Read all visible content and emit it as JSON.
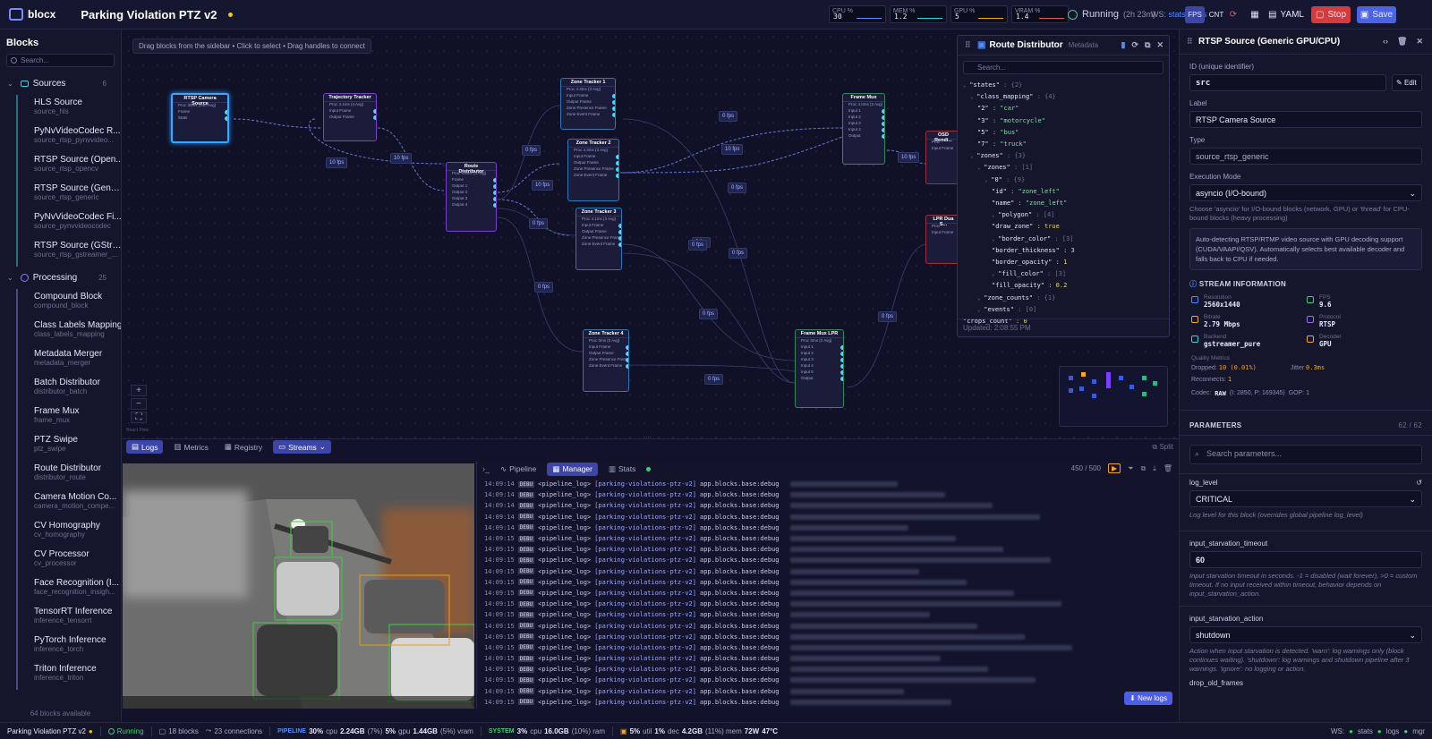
{
  "app": {
    "name": "blocx",
    "pipeline_title": "Parking Violation PTZ v2"
  },
  "monitors": [
    {
      "label": "CPU %",
      "value": "30",
      "color": "#5b8cff"
    },
    {
      "label": "MEM %",
      "value": "1.2",
      "color": "#3fd0e0"
    },
    {
      "label": "GPU %",
      "value": "5",
      "color": "#f5a623"
    },
    {
      "label": "VRAM %",
      "value": "1.4",
      "color": "#e05b5b"
    }
  ],
  "topbar": {
    "status": "Running",
    "uptime": "(2h 23m)",
    "ws_prefix": "WS:",
    "ws_links": "stats / logs",
    "fps_btn": "FPS",
    "cnt_btn": "CNT",
    "yaml_btn": "YAML",
    "stop_btn": "Stop",
    "save_btn": "Save"
  },
  "sidebar": {
    "title": "Blocks",
    "search_placeholder": "Search...",
    "sources": {
      "label": "Sources",
      "count": "6",
      "items": [
        {
          "name": "HLS Source",
          "type": "source_hls"
        },
        {
          "name": "PyNvVideoCodec R...",
          "type": "source_rtsp_pynvvideo..."
        },
        {
          "name": "RTSP Source (Open...",
          "type": "source_rtsp_opencv"
        },
        {
          "name": "RTSP Source (Gener...",
          "type": "source_rtsp_generic"
        },
        {
          "name": "PyNvVideoCodec Fi...",
          "type": "source_pynvvideocodec"
        },
        {
          "name": "RTSP Source (GStre...",
          "type": "source_rtsp_gstreamer_..."
        }
      ]
    },
    "processing": {
      "label": "Processing",
      "count": "25",
      "items": [
        {
          "name": "Compound Block",
          "type": "compound_block"
        },
        {
          "name": "Class Labels Mapping",
          "type": "class_labels_mapping"
        },
        {
          "name": "Metadata Merger",
          "type": "metadata_merger"
        },
        {
          "name": "Batch Distributor",
          "type": "distributor_batch"
        },
        {
          "name": "Frame Mux",
          "type": "frame_mux"
        },
        {
          "name": "PTZ Swipe",
          "type": "ptz_swipe"
        },
        {
          "name": "Route Distributor",
          "type": "distributor_route"
        },
        {
          "name": "Camera Motion Co...",
          "type": "camera_motion_compe..."
        },
        {
          "name": "CV Homography",
          "type": "cv_homography"
        },
        {
          "name": "CV Processor",
          "type": "cv_processor"
        },
        {
          "name": "Face Recognition (I...",
          "type": "face_recognition_insigh..."
        },
        {
          "name": "TensorRT Inference",
          "type": "inference_tensorrt"
        },
        {
          "name": "PyTorch Inference",
          "type": "inference_torch"
        },
        {
          "name": "Triton Inference",
          "type": "inference_triton"
        }
      ]
    },
    "footer": "64 blocks available"
  },
  "canvas": {
    "hint": "Drag blocks from the sidebar • Click to select • Drag handles to connect",
    "attribution": "React Flow",
    "nodes": [
      {
        "id": "rtsp",
        "title": "RTSP Camera Source",
        "rows": [
          "Proc 30ms (14fr.Avg)",
          "Frame",
          "Stats"
        ]
      },
      {
        "id": "traj",
        "title": "Trajectory Tracker",
        "rows": [
          "Proc 4.1ms (4 Avg)",
          "Input Frame",
          "Output Frame"
        ]
      },
      {
        "id": "route",
        "title": "Route Distributor",
        "rows": [
          "Proc 4.6ms (3 Avg)",
          "Frame",
          "Output 1",
          "Output 2",
          "Output 3",
          "Output 4"
        ]
      },
      {
        "id": "zt1",
        "title": "Zone Tracker 1",
        "rows": [
          "Proc 4.3ms (3 Avg)",
          "Input Frame",
          "Output Frame",
          "Zone Presence Frame",
          "Zone Event Frame"
        ]
      },
      {
        "id": "zt2",
        "title": "Zone Tracker 2",
        "rows": [
          "Proc 4.3ms (3 Avg)",
          "Input Frame",
          "Output Frame",
          "Zone Presence Frame",
          "Zone Event Frame"
        ]
      },
      {
        "id": "zt3",
        "title": "Zone Tracker 3",
        "rows": [
          "Proc 4.1ms (3 Avg)",
          "Input Frame",
          "Output Frame",
          "Zone Presence Frame",
          "Zone Event Frame"
        ]
      },
      {
        "id": "zt4",
        "title": "Zone Tracker 4",
        "rows": [
          "Proc 0ms (0 Avg)",
          "Input Frame",
          "Output Frame",
          "Zone Presence Frame",
          "Zone Event Frame"
        ]
      },
      {
        "id": "fmux",
        "title": "Frame Mux",
        "rows": [
          "Proc 4.0ms (3 Avg)",
          "Input 1",
          "Input 2",
          "Input 3",
          "Input 4",
          "Output"
        ]
      },
      {
        "id": "fmuxlpr",
        "title": "Frame Mux LPR",
        "rows": [
          "Proc 0ms (0 Avg)",
          "Input 1",
          "Input 2",
          "Input 3",
          "Input 4",
          "Input 5",
          "Output"
        ]
      },
      {
        "id": "osd",
        "title": "OSD Rendi...",
        "rows": [
          "Proc",
          "Input Frame"
        ]
      },
      {
        "id": "lpr",
        "title": "LPR Dua S...",
        "rows": [
          "Proc",
          "Input Frame"
        ]
      }
    ],
    "fps_labels": [
      "10 fps",
      "10 fps",
      "0 fps",
      "0 fps",
      "10 fps",
      "0 fps",
      "10 fps",
      "0 fps",
      "0 fps",
      "0 fps",
      "0 fps",
      "0 fps",
      "0 fps",
      "0 fps",
      "0 fps",
      "10 fps"
    ]
  },
  "route_panel": {
    "title": "Route Distributor",
    "subtitle": "Metadata",
    "search_placeholder": "Search...",
    "json_lines": [
      {
        "indent": 0,
        "key": "\"states\"",
        "val": ": {2}",
        "t": "g"
      },
      {
        "indent": 1,
        "key": "\"class_mapping\"",
        "val": ": {4}",
        "t": "g"
      },
      {
        "indent": 2,
        "key": "\"2\"",
        "val": ": \"car\"",
        "t": "s"
      },
      {
        "indent": 2,
        "key": "\"3\"",
        "val": ": \"motorcycle\"",
        "t": "s"
      },
      {
        "indent": 2,
        "key": "\"5\"",
        "val": ": \"bus\"",
        "t": "s"
      },
      {
        "indent": 2,
        "key": "\"7\"",
        "val": ": \"truck\"",
        "t": "s"
      },
      {
        "indent": 1,
        "key": "\"zones\"",
        "val": ": {3}",
        "t": "g"
      },
      {
        "indent": 2,
        "key": "\"zones\"",
        "val": ": [1]",
        "t": "g"
      },
      {
        "indent": 3,
        "key": "\"0\"",
        "val": ": {9}",
        "t": "g"
      },
      {
        "indent": 4,
        "key": "\"id\"",
        "val": ": \"zone_left\"",
        "t": "s"
      },
      {
        "indent": 4,
        "key": "\"name\"",
        "val": ": \"zone_left\"",
        "t": "s"
      },
      {
        "indent": 4,
        "key": "\"polygon\"",
        "val": ": [4]",
        "t": "g"
      },
      {
        "indent": 4,
        "key": "\"draw_zone\"",
        "val": ": true",
        "t": "n"
      },
      {
        "indent": 4,
        "key": "\"border_color\"",
        "val": ": [3]",
        "t": "g"
      },
      {
        "indent": 4,
        "key": "\"border_thickness\"",
        "val": ": 3",
        "t": "n"
      },
      {
        "indent": 4,
        "key": "\"border_opacity\"",
        "val": ": 1",
        "t": "n"
      },
      {
        "indent": 4,
        "key": "\"fill_color\"",
        "val": ": [3]",
        "t": "g"
      },
      {
        "indent": 4,
        "key": "\"fill_opacity\"",
        "val": ": 0.2",
        "t": "n"
      },
      {
        "indent": 2,
        "key": "\"zone_counts\"",
        "val": ": {1}",
        "t": "g"
      },
      {
        "indent": 2,
        "key": "\"events\"",
        "val": ": [0]",
        "t": "g"
      },
      {
        "indent": 0,
        "key": "\"crops_count\"",
        "val": ": 0",
        "t": "n"
      }
    ],
    "updated": "Updated: 2:08:55 PM"
  },
  "bottom": {
    "tabs": [
      "Logs",
      "Metrics",
      "Registry",
      "Streams"
    ],
    "split_label": "Split",
    "log_tabs": [
      "Pipeline",
      "Manager",
      "Stats"
    ],
    "log_count": "450 / 500",
    "new_logs_btn": "New logs",
    "log_rows": [
      {
        "time": "14:09:14",
        "level": "DEBU",
        "src": "<pipeline_log>",
        "pipe": "[parking-violations-ptz-v2]",
        "logger": "app.blocks.base:debug"
      },
      {
        "time": "14:09:14",
        "level": "DEBU",
        "src": "<pipeline_log>",
        "pipe": "[parking-violations-ptz-v2]",
        "logger": "app.blocks.base:debug"
      },
      {
        "time": "14:09:14",
        "level": "DEBU",
        "src": "<pipeline_log>",
        "pipe": "[parking-violations-ptz-v2]",
        "logger": "app.blocks.base:debug"
      },
      {
        "time": "14:09:14",
        "level": "DEBU",
        "src": "<pipeline_log>",
        "pipe": "[parking-violations-ptz-v2]",
        "logger": "app.blocks.base:debug"
      },
      {
        "time": "14:09:14",
        "level": "DEBU",
        "src": "<pipeline_log>",
        "pipe": "[parking-violations-ptz-v2]",
        "logger": "app.blocks.base:debug"
      },
      {
        "time": "14:09:15",
        "level": "DEBU",
        "src": "<pipeline_log>",
        "pipe": "[parking-violations-ptz-v2]",
        "logger": "app.blocks.base:debug"
      },
      {
        "time": "14:09:15",
        "level": "DEBU",
        "src": "<pipeline_log>",
        "pipe": "[parking-violations-ptz-v2]",
        "logger": "app.blocks.base:debug"
      },
      {
        "time": "14:09:15",
        "level": "DEBU",
        "src": "<pipeline_log>",
        "pipe": "[parking-violations-ptz-v2]",
        "logger": "app.blocks.base:debug"
      },
      {
        "time": "14:09:15",
        "level": "DEBU",
        "src": "<pipeline_log>",
        "pipe": "[parking-violations-ptz-v2]",
        "logger": "app.blocks.base:debug"
      },
      {
        "time": "14:09:15",
        "level": "DEBU",
        "src": "<pipeline_log>",
        "pipe": "[parking-violations-ptz-v2]",
        "logger": "app.blocks.base:debug"
      },
      {
        "time": "14:09:15",
        "level": "DEBU",
        "src": "<pipeline_log>",
        "pipe": "[parking-violations-ptz-v2]",
        "logger": "app.blocks.base:debug"
      },
      {
        "time": "14:09:15",
        "level": "DEBU",
        "src": "<pipeline_log>",
        "pipe": "[parking-violations-ptz-v2]",
        "logger": "app.blocks.base:debug"
      },
      {
        "time": "14:09:15",
        "level": "DEBU",
        "src": "<pipeline_log>",
        "pipe": "[parking-violations-ptz-v2]",
        "logger": "app.blocks.base:debug"
      },
      {
        "time": "14:09:15",
        "level": "DEBU",
        "src": "<pipeline_log>",
        "pipe": "[parking-violations-ptz-v2]",
        "logger": "app.blocks.base:debug"
      },
      {
        "time": "14:09:15",
        "level": "DEBU",
        "src": "<pipeline_log>",
        "pipe": "[parking-violations-ptz-v2]",
        "logger": "app.blocks.base:debug"
      },
      {
        "time": "14:09:15",
        "level": "DEBU",
        "src": "<pipeline_log>",
        "pipe": "[parking-violations-ptz-v2]",
        "logger": "app.blocks.base:debug"
      },
      {
        "time": "14:09:15",
        "level": "DEBU",
        "src": "<pipeline_log>",
        "pipe": "[parking-violations-ptz-v2]",
        "logger": "app.blocks.base:debug"
      },
      {
        "time": "14:09:15",
        "level": "DEBU",
        "src": "<pipeline_log>",
        "pipe": "[parking-violations-ptz-v2]",
        "logger": "app.blocks.base:debug"
      },
      {
        "time": "14:09:15",
        "level": "DEBU",
        "src": "<pipeline_log>",
        "pipe": "[parking-violations-ptz-v2]",
        "logger": "app.blocks.base:debug"
      },
      {
        "time": "14:09:15",
        "level": "DEBU",
        "src": "<pipeline_log>",
        "pipe": "[parking-violations-ptz-v2]",
        "logger": "app.blocks.base:debug"
      },
      {
        "time": "14:09:15",
        "level": "DEBU",
        "src": "<pipeline_log>",
        "pipe": "[parking-violations-ptz-v2]",
        "logger": "app.blocks.base:debug"
      }
    ]
  },
  "inspector": {
    "title": "RTSP Source (Generic GPU/CPU)",
    "id_label": "ID (unique identifier)",
    "id_value": "src",
    "edit_btn": "Edit",
    "label_label": "Label",
    "label_value": "RTSP Camera Source",
    "type_label": "Type",
    "type_value": "source_rtsp_generic",
    "exec_label": "Execution Mode",
    "exec_value": "asyncio (I/O-bound)",
    "exec_desc": "Choose 'asyncio' for I/O-bound blocks (network, GPU) or 'thread' for CPU-bound blocks (heavy processing)",
    "info": "Auto-detecting RTSP/RTMP video source with GPU decoding support (CUDA/VAAPI/QSV). Automatically selects best available decoder and falls back to CPU if needed.",
    "stream_title": "STREAM INFORMATION",
    "stream": [
      {
        "label": "Resolution",
        "value": "2560x1440",
        "color": "#4f8cff"
      },
      {
        "label": "FPS",
        "value": "9.6",
        "color": "#3ecf6e"
      },
      {
        "label": "Bitrate",
        "value": "2.79 Mbps",
        "color": "#f5a623"
      },
      {
        "label": "Protocol",
        "value": "RTSP",
        "color": "#a46bff"
      },
      {
        "label": "Backend",
        "value": "gstreamer_pure",
        "color": "#3fd0e0"
      },
      {
        "label": "Decoder",
        "value": "GPU",
        "color": "#f5a623"
      }
    ],
    "quality_title": "Quality Metrics",
    "dropped_label": "Dropped:",
    "dropped_value": "10 (0.01%)",
    "jitter_label": "Jitter",
    "jitter_value": "0.3ms",
    "reconnects_label": "Reconnects:",
    "reconnects_value": "1",
    "codec_label": "Codec:",
    "codec_value": "RAW",
    "codec_extra": "(I: 2850, P: 169345)",
    "gop": "GOP: 1",
    "params_title": "PARAMETERS",
    "params_count": "62 / 62",
    "params_search": "Search parameters...",
    "p1_label": "log_level",
    "p1_value": "CRITICAL",
    "p1_desc": "Log level for this block (overrides global pipeline log_level)",
    "p2_label": "input_starvation_timeout",
    "p2_value": "60",
    "p2_desc": "Input starvation timeout in seconds. -1 = disabled (wait forever), >0 = custom timeout. If no input received within timeout, behavior depends on input_starvation_action.",
    "p3_label": "input_starvation_action",
    "p3_value": "shutdown",
    "p3_desc": "Action when input starvation is detected. 'warn': log warnings only (block continues waiting). 'shutdown': log warnings and shutdown pipeline after 3 warnings. 'ignore': no logging or action.",
    "p4_label": "drop_old_frames"
  },
  "statusbar": {
    "title": "Parking Violation PTZ v2",
    "state": "Running",
    "blocks": "18 blocks",
    "connections": "23 connections",
    "pipeline_label": "PIPELINE",
    "pipeline_cpu": "30%",
    "pipeline_cpu_unit": "cpu",
    "pipeline_ram": "2.24GB",
    "pipeline_ram_pct": "(7%)",
    "pipeline_gpu": "5%",
    "pipeline_gpu_unit": "gpu",
    "pipeline_vram": "1.44GB",
    "pipeline_vram_pct": "(5%) vram",
    "system_label": "SYSTEM",
    "sys_cpu": "3%",
    "sys_cpu_unit": "cpu",
    "sys_ram": "16.0GB",
    "sys_ram_pct": "(10%) ram",
    "gpu_util": "5%",
    "gpu_util_unit": "util",
    "gpu_dec": "1%",
    "gpu_dec_unit": "dec",
    "gpu_mem": "4.2GB",
    "gpu_mem_pct": "(11%) mem",
    "gpu_power": "72W",
    "gpu_temp": "47°C",
    "ws_label": "WS:",
    "ws_stats": "stats",
    "ws_logs": "logs",
    "ws_mgr": "mgr"
  }
}
